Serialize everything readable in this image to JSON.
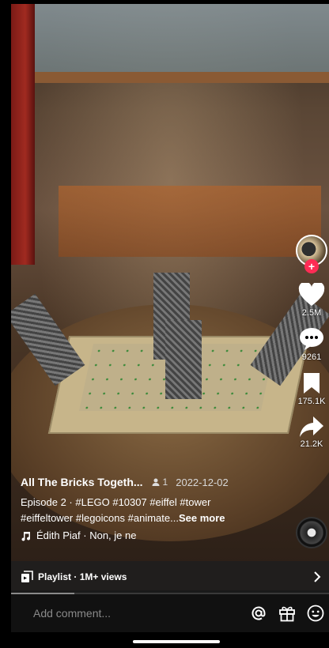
{
  "video": {
    "title": "All The Bricks Togeth...",
    "view_count": "1",
    "date": "2022-12-02",
    "caption_lines": [
      "Episode 2 · #LEGO #10307 #eiffel #tower",
      "#eiffeltower #legoicons #animate..."
    ],
    "see_more": "See more",
    "music": "Édith Piaf · Non, je ne"
  },
  "actions": {
    "likes": "2.5M",
    "comments": "9261",
    "saves": "175.1K",
    "shares": "21.2K"
  },
  "playlist": {
    "label": "Playlist · 1M+ views"
  },
  "playback": {
    "progress": 0.2
  },
  "comment_bar": {
    "placeholder": "Add comment..."
  },
  "colors": {
    "follow_accent": "#fe2c55",
    "background": "#000000"
  },
  "icons": [
    "heart-icon",
    "comment-icon",
    "bookmark-icon",
    "share-icon",
    "playlist-icon",
    "chevron-right-icon",
    "at-icon",
    "gift-icon",
    "emoji-icon",
    "music-note-icon",
    "person-icon",
    "plus-icon"
  ]
}
